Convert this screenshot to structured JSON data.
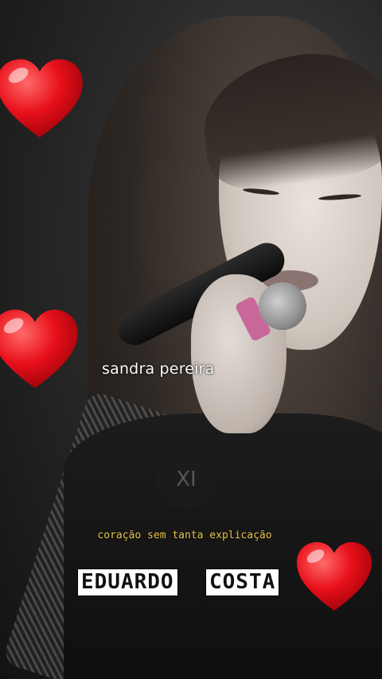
{
  "video": {
    "username": "sandra pereira",
    "lyric_line": "coração sem tanta explicação",
    "artist_first": "EDUARDO",
    "artist_last": "COSTA",
    "watermark_glyph": "XI"
  },
  "icons": {
    "heart_top": "heart-icon",
    "heart_middle": "heart-icon",
    "heart_bottom": "heart-icon"
  },
  "colors": {
    "heart": "#e8101a",
    "lyrics": "#e9c64a",
    "artist_bg": "#ffffff"
  }
}
